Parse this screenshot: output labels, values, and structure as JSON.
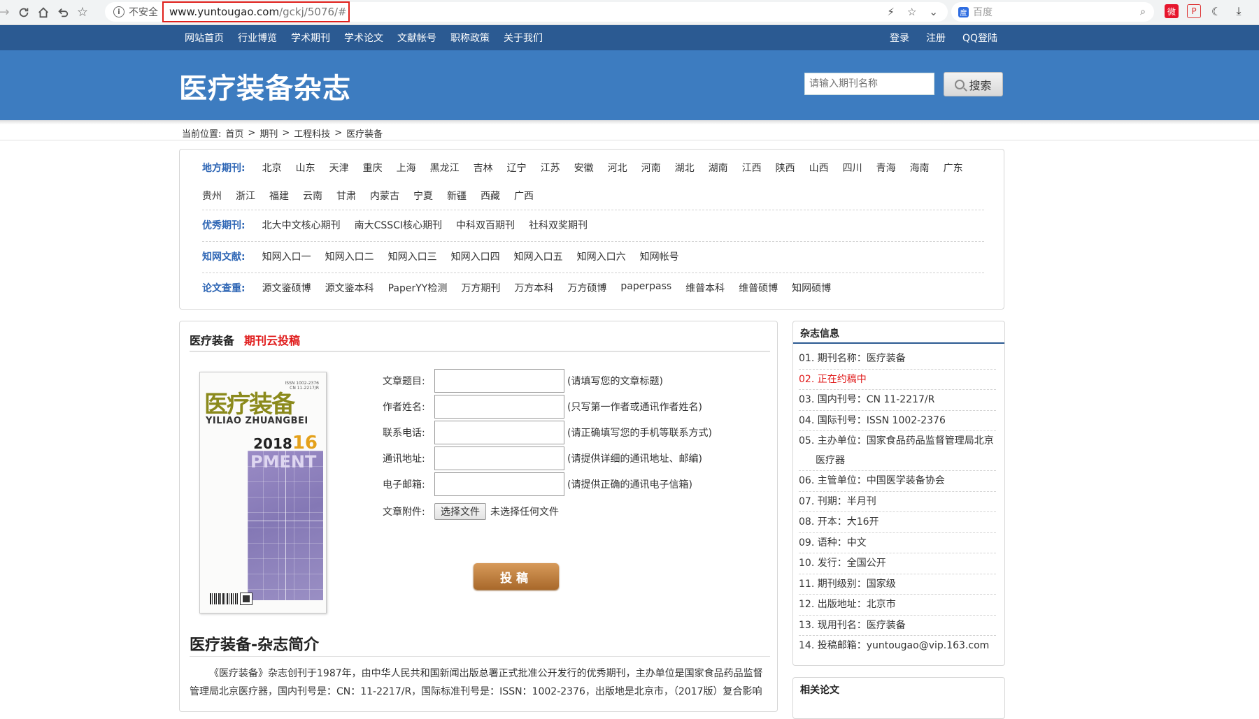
{
  "browser": {
    "security_label": "不安全",
    "url_host": "www.yuntougao.com",
    "url_path": "/gckj/5076/#",
    "search_engine_placeholder": "百度"
  },
  "topnav": {
    "links": [
      "网站首页",
      "行业博览",
      "学术期刊",
      "学术论文",
      "文献帐号",
      "职称政策",
      "关于我们"
    ],
    "auth": [
      "登录",
      "注册",
      "QQ登陆"
    ]
  },
  "banner": {
    "title": "医疗装备杂志",
    "search_placeholder": "请输入期刊名称",
    "search_button": "搜索"
  },
  "breadcrumb": {
    "prefix": "当前位置:",
    "items": [
      "首页",
      "期刊",
      "工程科技",
      "医疗装备"
    ],
    "sep": ">"
  },
  "categories": {
    "local": {
      "label": "地方期刊:",
      "row1": [
        "北京",
        "山东",
        "天津",
        "重庆",
        "上海",
        "黑龙江",
        "吉林",
        "辽宁",
        "江苏",
        "安徽",
        "河北",
        "河南",
        "湖北",
        "湖南",
        "江西",
        "陕西",
        "山西",
        "四川",
        "青海",
        "海南",
        "广东"
      ],
      "row2": [
        "贵州",
        "浙江",
        "福建",
        "云南",
        "甘肃",
        "内蒙古",
        "宁夏",
        "新疆",
        "西藏",
        "广西"
      ]
    },
    "excellent": {
      "label": "优秀期刊:",
      "items": [
        "北大中文核心期刊",
        "南大CSSCI核心期刊",
        "中科双百期刊",
        "社科双奖期刊"
      ]
    },
    "cnki": {
      "label": "知网文献:",
      "items": [
        "知网入口一",
        "知网入口二",
        "知网入口三",
        "知网入口四",
        "知网入口五",
        "知网入口六",
        "知网帐号"
      ]
    },
    "check": {
      "label": "论文查重:",
      "items": [
        "源文鉴硕博",
        "源文鉴本科",
        "PaperYY检测",
        "万方期刊",
        "万方本科",
        "万方硕博",
        "paperpass",
        "维普本科",
        "维普硕博",
        "知网硕博"
      ]
    }
  },
  "main": {
    "heading": "医疗装备",
    "tag": "期刊云投稿",
    "cover": {
      "title_cn": "医疗装备",
      "title_py": "YILIAO ZHUANGBEI",
      "year": "2018",
      "issue": "16",
      "art_text": "PMENT"
    },
    "form": {
      "fields": [
        {
          "label": "文章题目:",
          "hint": "(请填写您的文章标题)"
        },
        {
          "label": "作者姓名:",
          "hint": "(只写第一作者或通讯作者姓名)"
        },
        {
          "label": "联系电话:",
          "hint": "(请正确填写您的手机等联系方式)"
        },
        {
          "label": "通讯地址:",
          "hint": "(请提供详细的通讯地址、邮编)"
        },
        {
          "label": "电子邮箱:",
          "hint": "(请提供正确的通讯电子信箱)"
        }
      ],
      "attachment_label": "文章附件:",
      "file_button": "选择文件",
      "file_status": "未选择任何文件",
      "submit": "投稿"
    },
    "intro_title": "医疗装备-杂志简介",
    "intro_text": "《医疗装备》杂志创刊于1987年，由中华人民共和国新闻出版总署正式批准公开发行的优秀期刊，主办单位是国家食品药品监督管理局北京医疗器，国内刊号是：CN：11-2217/R，国际标准刊号是：ISSN：1002-2376，出版地是北京市，（2017版）复合影响"
  },
  "sidebar": {
    "heading": "杂志信息",
    "items": [
      "01. 期刊名称：医疗装备",
      "02. 正在约稿中",
      "03. 国内刊号：CN 11-2217/R",
      "04. 国际刊号：ISSN 1002-2376",
      "05. 主办单位：国家食品药品监督管理局北京医疗器",
      "06. 主管单位：中国医学装备协会",
      "07. 刊期：半月刊",
      "08. 开本：大16开",
      "09. 语种：中文",
      "10. 发行：全国公开",
      "11. 期刊级别：国家级",
      "12. 出版地址：北京市",
      "13. 现用刊名：医疗装备",
      "14. 投稿邮箱：yuntougao@vip.163.com"
    ],
    "related_heading": "相关论文"
  },
  "colors": {
    "topnav_bg": "#2b5a92",
    "banner_bg": "#3d7cc0",
    "accent_red": "#e01b1b",
    "label_blue": "#2e66b5"
  }
}
